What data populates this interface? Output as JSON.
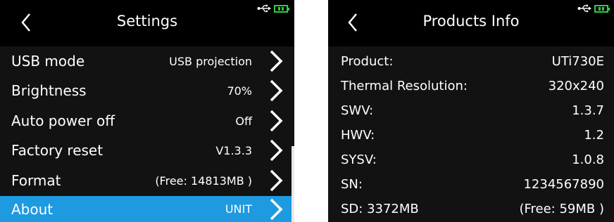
{
  "settings": {
    "title": "Settings",
    "rows": [
      {
        "label": "USB mode",
        "value": "USB projection"
      },
      {
        "label": "Brightness",
        "value": "70%"
      },
      {
        "label": "Auto power off",
        "value": "Off"
      },
      {
        "label": "Factory reset",
        "value": "V1.3.3"
      },
      {
        "label": "Format",
        "value": "(Free: 14813MB )"
      },
      {
        "label": "About",
        "value": "UNIT"
      }
    ],
    "selected_row": 5
  },
  "products_info": {
    "title": "Products Info",
    "rows": [
      {
        "label": "Product:",
        "value": "UTi730E"
      },
      {
        "label": "Thermal Resolution:",
        "value": "320x240"
      },
      {
        "label": "SWV:",
        "value": "1.3.7"
      },
      {
        "label": "HWV:",
        "value": "1.2"
      },
      {
        "label": "SYSV:",
        "value": "1.0.8"
      },
      {
        "label": "SN:",
        "value": "1234567890"
      },
      {
        "label": "SD: 3372MB",
        "value": "(Free: 59MB )"
      }
    ]
  },
  "status": {
    "usb_icon": "usb-icon",
    "battery_icon": "battery-charging-icon"
  },
  "colors": {
    "background": "#121212",
    "topbar": "#000000",
    "selected": "#1e9ae0",
    "battery": "#2ecc40"
  }
}
